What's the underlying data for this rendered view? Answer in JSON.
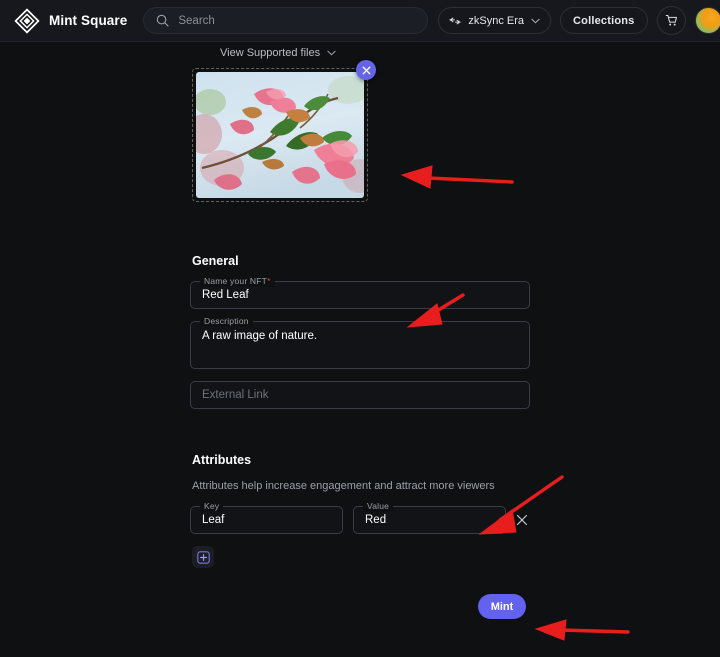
{
  "header": {
    "brand_name": "Mint Square",
    "logo_icon": "diamond-logo-icon",
    "search_placeholder": "Search",
    "search_value": "",
    "search_icon": "search-icon",
    "network_label": "zkSync Era",
    "network_icon": "network-swap-icon",
    "network_chevron": "chevron-down-icon",
    "collections_label": "Collections",
    "cart_icon": "cart-icon",
    "avatar_icon": "user-avatar"
  },
  "upload": {
    "supported_files_label": "View Supported files",
    "supported_chevron": "chevron-down-icon",
    "close_icon": "close-icon",
    "preview_alt": "pink bougainvillea flowers with green leaves"
  },
  "general": {
    "title": "General",
    "name_label": "Name your NFT",
    "name_required_mark": "*",
    "name_value": "Red Leaf",
    "description_label": "Description",
    "description_value": "A raw image of nature.",
    "external_link_placeholder": "External Link",
    "external_link_value": ""
  },
  "attributes": {
    "title": "Attributes",
    "note": "Attributes help increase engagement and attract more viewers",
    "key_label": "Key",
    "value_label": "Value",
    "rows": [
      {
        "key": "Leaf",
        "value": "Red"
      }
    ],
    "remove_icon": "close-icon",
    "add_icon": "add-attribute-icon"
  },
  "actions": {
    "mint_label": "Mint"
  },
  "colors": {
    "page_background": "#0f1012",
    "header_background": "#16181d",
    "accent_purple": "#6361ef",
    "annotation_red": "#e81e1e",
    "required_red": "#e2413a",
    "field_border": "#3a3d45",
    "muted_text": "#9aa0aa"
  },
  "annotations": {
    "arrow_count": 4,
    "arrow_color": "#e81e1e",
    "targets": [
      "image-preview",
      "name-field",
      "attributes-row",
      "mint-button"
    ]
  }
}
